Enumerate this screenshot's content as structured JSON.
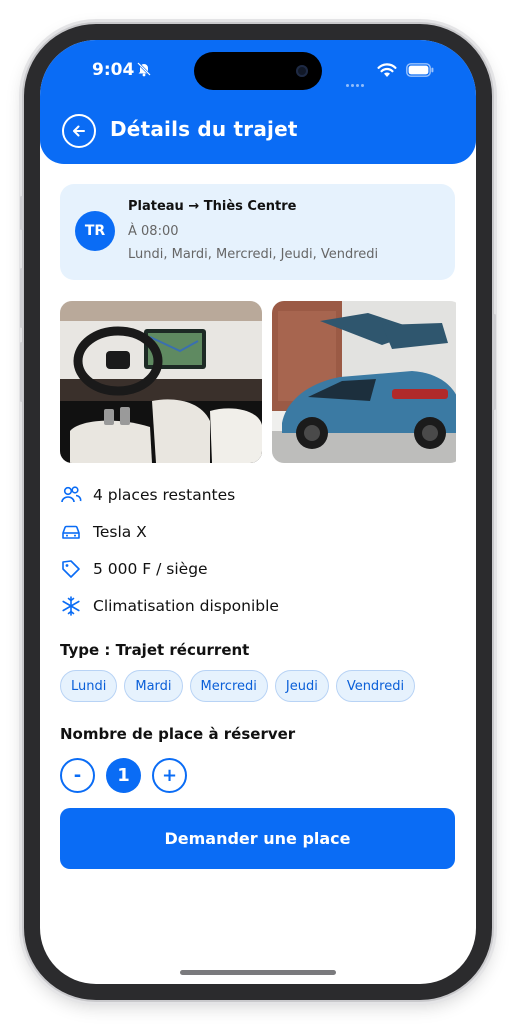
{
  "status_bar": {
    "time": "9:04",
    "icons": [
      "bell-off-icon",
      "signal-dots-icon",
      "wifi-icon",
      "battery-icon"
    ]
  },
  "header": {
    "title": "Détails du trajet",
    "back_icon": "arrow-left-icon"
  },
  "trip": {
    "avatar_initials": "TR",
    "route": "Plateau → Thiès Centre",
    "time": "À 08:00",
    "days": "Lundi, Mardi, Mercredi, Jeudi, Vendredi"
  },
  "gallery": {
    "photos": [
      "car-interior-photo",
      "car-exterior-photo"
    ]
  },
  "details": [
    {
      "icon": "users-icon",
      "text": "4 places restantes"
    },
    {
      "icon": "car-icon",
      "text": "Tesla X"
    },
    {
      "icon": "tag-icon",
      "text": "5 000 F / siège"
    },
    {
      "icon": "snowflake-icon",
      "text": "Climatisation disponible"
    }
  ],
  "type_section": {
    "title": "Type : Trajet récurrent",
    "days": [
      "Lundi",
      "Mardi",
      "Mercredi",
      "Jeudi",
      "Vendredi"
    ]
  },
  "seats_section": {
    "title": "Nombre de place à réserver",
    "minus": "-",
    "value": "1",
    "plus": "+"
  },
  "cta": {
    "label": "Demander une place"
  },
  "colors": {
    "primary": "#0a6cf5",
    "card_bg": "#e6f2fd",
    "chip_border": "#b8d3f5"
  }
}
